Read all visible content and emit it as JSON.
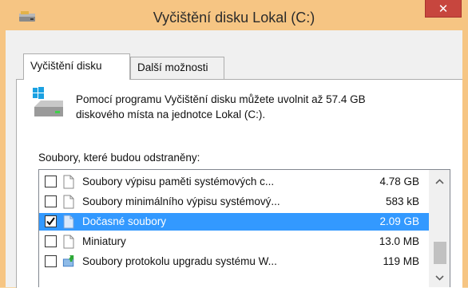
{
  "window": {
    "title": "Vyčištění disku Lokal (C:)",
    "close_glyph": "✕",
    "icons": {
      "title": "disk-cleanup-icon"
    }
  },
  "tabs": [
    {
      "label": "Vyčištění disku",
      "active": true
    },
    {
      "label": "Další možnosti",
      "active": false
    }
  ],
  "description": {
    "line1": "Pomocí programu Vyčištění disku můžete uvolnit až 57.4 GB",
    "line2": "diskového místa na jednotce Lokal (C:).",
    "icon": "drive-icon"
  },
  "files_label": "Soubory, které budou odstraněny:",
  "files": [
    {
      "name": "Soubory výpisu paměti systémových c...",
      "size": "4.78 GB",
      "checked": false,
      "selected": false,
      "icon": "file-icon"
    },
    {
      "name": "Soubory minimálního výpisu systémový...",
      "size": "583 kB",
      "checked": false,
      "selected": false,
      "icon": "file-icon"
    },
    {
      "name": "Dočasné soubory",
      "size": "2.09 GB",
      "checked": true,
      "selected": true,
      "icon": "file-icon"
    },
    {
      "name": "Miniatury",
      "size": "13.0 MB",
      "checked": false,
      "selected": false,
      "icon": "file-icon"
    },
    {
      "name": "Soubory protokolu upgradu systému W...",
      "size": "119 MB",
      "checked": false,
      "selected": false,
      "icon": "upgrade-log-icon"
    }
  ],
  "colors": {
    "titlebar": "#f6c583",
    "close": "#c7463e",
    "selection": "#3399ff"
  }
}
